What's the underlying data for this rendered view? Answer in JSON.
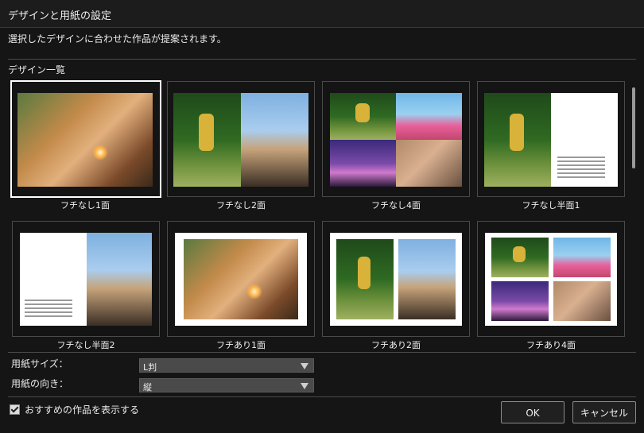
{
  "window": {
    "title": "デザインと用紙の設定"
  },
  "description": "選択したデザインに合わせた作品が提案されます。",
  "design_list": {
    "label": "デザイン一覧",
    "items": [
      {
        "caption": "フチなし1面",
        "selected": true
      },
      {
        "caption": "フチなし2面",
        "selected": false
      },
      {
        "caption": "フチなし4面",
        "selected": false
      },
      {
        "caption": "フチなし半面1",
        "selected": false
      },
      {
        "caption": "フチなし半面2",
        "selected": false
      },
      {
        "caption": "フチあり1面",
        "selected": false
      },
      {
        "caption": "フチあり2面",
        "selected": false
      },
      {
        "caption": "フチあり4面",
        "selected": false
      }
    ]
  },
  "settings": {
    "paper_size_label": "用紙サイズ：",
    "paper_size_value": "L判",
    "orientation_label": "用紙の向き：",
    "orientation_value": "縦"
  },
  "footer": {
    "recommend_label": "おすすめの作品を表示する",
    "recommend_checked": true,
    "ok_label": "OK",
    "cancel_label": "キャンセル"
  }
}
